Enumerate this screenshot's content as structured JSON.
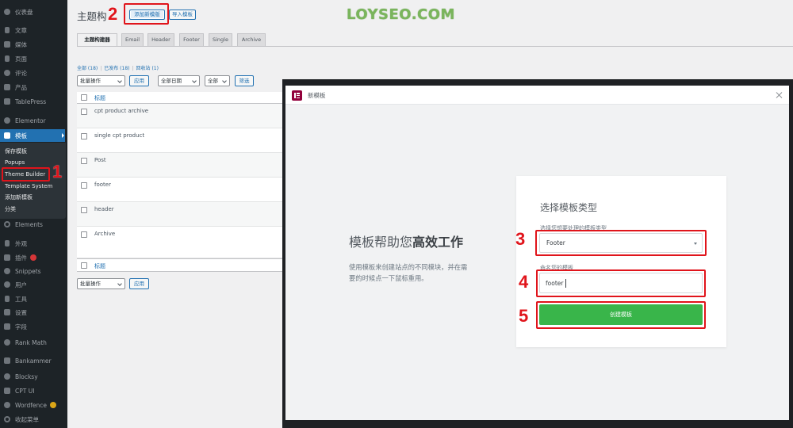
{
  "watermark": "LOYSEO.COM",
  "colors": {
    "sidebar_bg": "#1d2327",
    "accent": "#2271b1",
    "annotation": "#e0141b",
    "create_button": "#39b54a",
    "watermark": "#7ab55c",
    "elementor_logo": "#92003b"
  },
  "sidebar": {
    "top_items": [
      {
        "label": "仪表盘",
        "icon": "dashboard-icon"
      },
      {
        "label": "文章",
        "icon": "pin-icon"
      },
      {
        "label": "媒体",
        "icon": "media-icon"
      },
      {
        "label": "页面",
        "icon": "page-icon"
      },
      {
        "label": "评论",
        "icon": "comment-icon"
      },
      {
        "label": "产品",
        "icon": "product-icon"
      },
      {
        "label": "TablePress",
        "icon": "table-icon"
      },
      {
        "label": "Elementor",
        "icon": "elementor-icon"
      }
    ],
    "active": {
      "label": "模板",
      "icon": "folder-icon"
    },
    "submenu": [
      "保存模板",
      "Popups",
      "Theme Builder",
      "Template System",
      "添加新模板",
      "分类"
    ],
    "bottom_items": [
      {
        "label": "Elements",
        "icon": "elements-icon"
      },
      {
        "label": "外观",
        "icon": "appearance-icon"
      },
      {
        "label": "插件",
        "icon": "plugin-icon",
        "badge_color": "#d63638"
      },
      {
        "label": "Snippets",
        "icon": "snippets-icon"
      },
      {
        "label": "用户",
        "icon": "user-icon"
      },
      {
        "label": "工具",
        "icon": "tools-icon"
      },
      {
        "label": "设置",
        "icon": "settings-icon"
      },
      {
        "label": "字段",
        "icon": "fields-icon"
      },
      {
        "label": "Rank Math",
        "icon": "rank-math-icon"
      },
      {
        "label": "Bankammer",
        "icon": "bankammer-icon"
      },
      {
        "label": "Blocksy",
        "icon": "blocksy-icon"
      },
      {
        "label": "CPT UI",
        "icon": "cpt-ui-icon"
      },
      {
        "label": "Wordfence",
        "icon": "wordfence-icon",
        "badge_color": "#dba617"
      },
      {
        "label": "收起菜单",
        "icon": "collapse-icon"
      }
    ]
  },
  "header": {
    "title": "主题构",
    "add_new_label": "添加新模版",
    "import_label": "导入模板"
  },
  "tabs": [
    {
      "label": "主题构建器",
      "active": true
    },
    {
      "label": "Email"
    },
    {
      "label": "Header"
    },
    {
      "label": "Footer"
    },
    {
      "label": "Single"
    },
    {
      "label": "Archive"
    }
  ],
  "views": {
    "separator": "|",
    "items": [
      "全部 (18)",
      "已发布 (18)",
      "回收站 (1)"
    ]
  },
  "bulk_top": {
    "action": "批量操作",
    "apply": "应用",
    "date": "全部日期",
    "type": "全部",
    "filter": "筛选"
  },
  "table": {
    "column_title": "标题",
    "rows": [
      "cpt product archive",
      "single cpt product",
      "Post",
      "footer",
      "header",
      "Archive"
    ]
  },
  "bulk_bottom": {
    "action": "批量操作",
    "apply": "应用"
  },
  "modal": {
    "title": "新模板",
    "heading_regular": "模板帮助您",
    "heading_bold": "高效工作",
    "description_lines": [
      "使用模板来创建站点的不同模块，并在需",
      "要的时候点一下鼠标重用。"
    ],
    "card_title": "选择模板类型",
    "type_label": "选择您想要处理的模板类型",
    "type_value": "Footer",
    "name_label": "命名您的模板",
    "name_value": "footer",
    "create_label": "创建模板"
  },
  "annotations": [
    "1",
    "2",
    "3",
    "4",
    "5"
  ]
}
